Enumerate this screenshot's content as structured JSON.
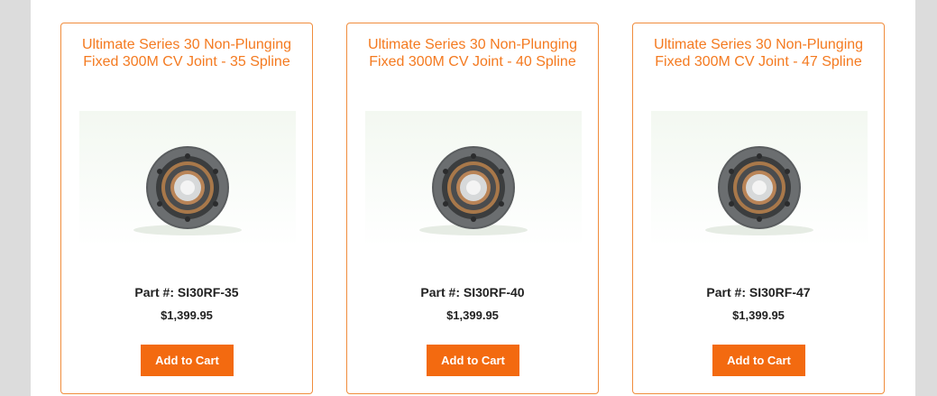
{
  "products": [
    {
      "title": "Ultimate Series 30 Non-Plunging Fixed 300M CV Joint - 35 Spline",
      "part_label": "Part #:",
      "part_number": "SI30RF-35",
      "price": "$1,399.95",
      "button": "Add to Cart",
      "image": "cv-joint-image"
    },
    {
      "title": "Ultimate Series 30 Non-Plunging Fixed 300M CV Joint - 40 Spline",
      "part_label": "Part #:",
      "part_number": "SI30RF-40",
      "price": "$1,399.95",
      "button": "Add to Cart",
      "image": "cv-joint-image"
    },
    {
      "title": "Ultimate Series 30 Non-Plunging Fixed 300M CV Joint - 47 Spline",
      "part_label": "Part #:",
      "part_number": "SI30RF-47",
      "price": "$1,399.95",
      "button": "Add to Cart",
      "image": "cv-joint-image"
    }
  ],
  "colors": {
    "accent": "#f47a20",
    "button": "#f36a10",
    "card_border": "#f08c3c"
  }
}
